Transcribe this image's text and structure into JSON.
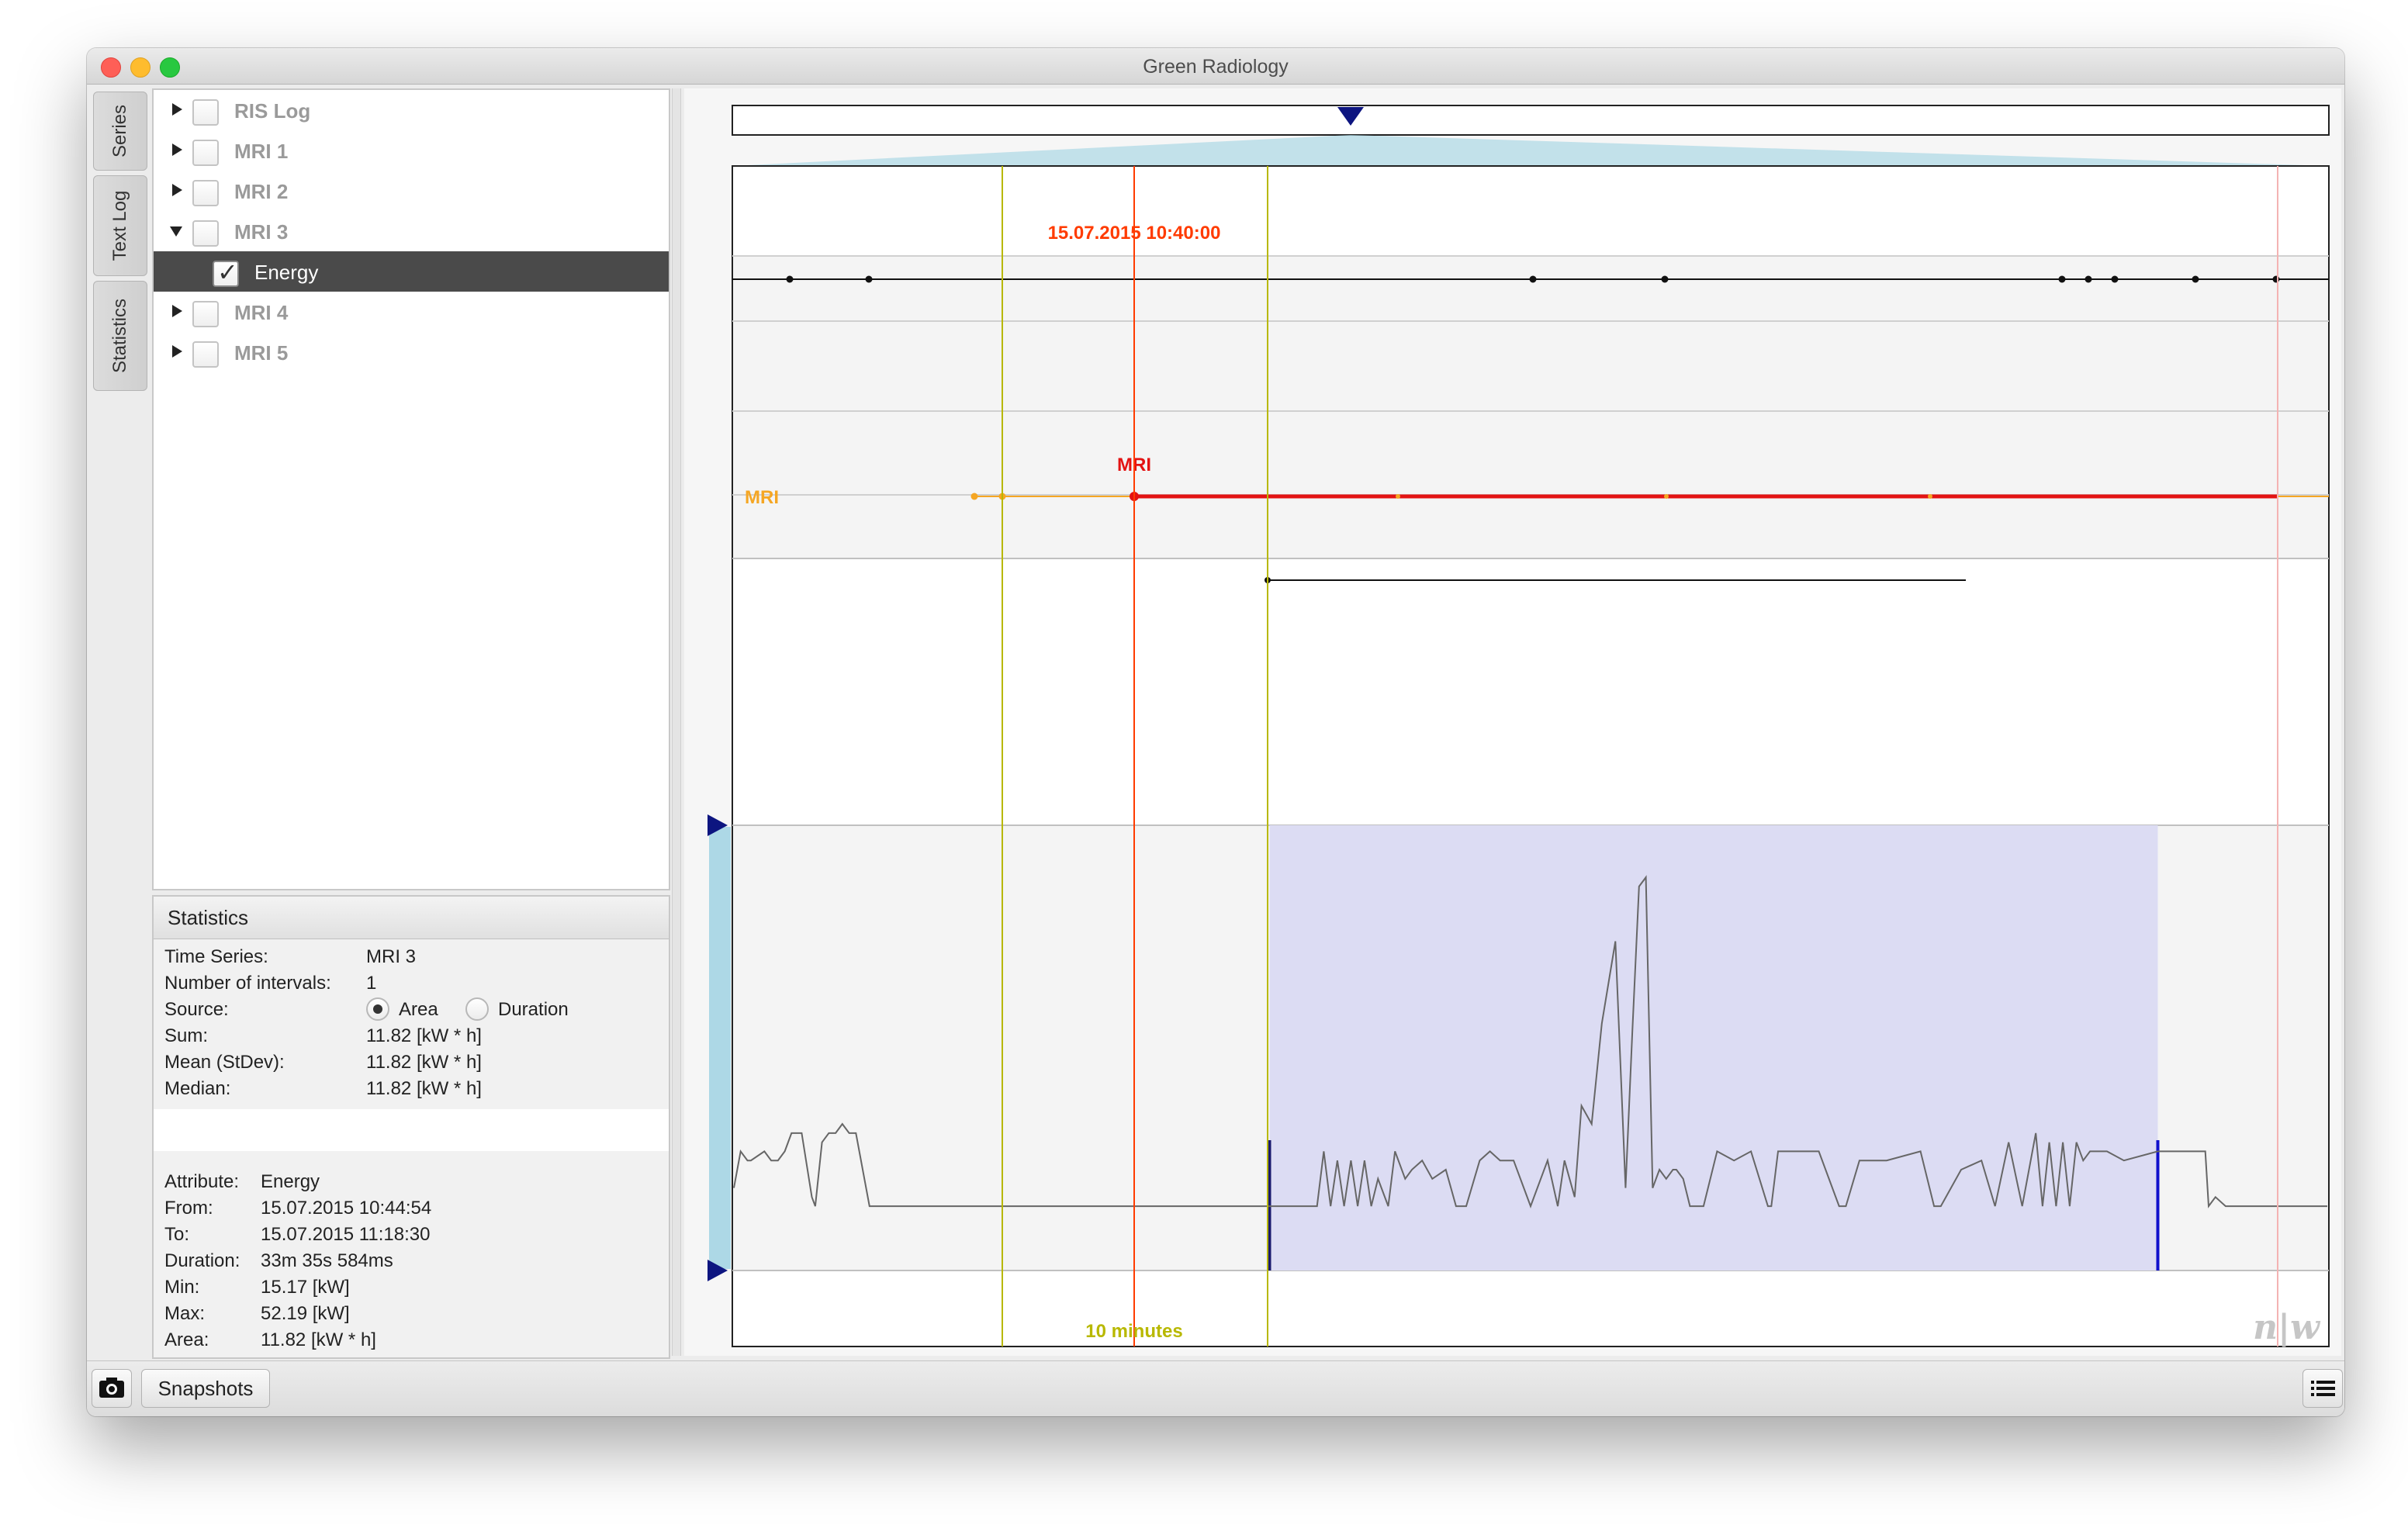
{
  "window": {
    "title": "Green Radiology"
  },
  "side_tabs": [
    {
      "label": "Series"
    },
    {
      "label": "Text Log"
    },
    {
      "label": "Statistics"
    }
  ],
  "tree": {
    "items": [
      {
        "label": "RIS Log",
        "expanded": false,
        "checked": false
      },
      {
        "label": "MRI 1",
        "expanded": false,
        "checked": false
      },
      {
        "label": "MRI 2",
        "expanded": false,
        "checked": false
      },
      {
        "label": "MRI 3",
        "expanded": true,
        "checked": false
      },
      {
        "label": "Energy",
        "child": true,
        "checked": true,
        "selected": true
      },
      {
        "label": "MRI 4",
        "expanded": false,
        "checked": false
      },
      {
        "label": "MRI 5",
        "expanded": false,
        "checked": false
      }
    ]
  },
  "statistics": {
    "header": "Statistics",
    "time_series_label": "Time Series:",
    "time_series_value": "MRI 3",
    "intervals_label": "Number of intervals:",
    "intervals_value": "1",
    "source_label": "Source:",
    "source_options": [
      "Area",
      "Duration"
    ],
    "source_selected": "Area",
    "sum_label": "Sum:",
    "sum_value": "11.82 [kW * h]",
    "mean_label": "Mean (StDev):",
    "mean_value": "11.82 [kW * h]",
    "median_label": "Median:",
    "median_value": "11.82 [kW * h]",
    "attribute_label": "Attribute:",
    "attribute_value": "Energy",
    "from_label": "From:",
    "from_value": "15.07.2015 10:44:54",
    "to_label": "To:",
    "to_value": "15.07.2015 11:18:30",
    "duration_label": "Duration:",
    "duration_value": "33m 35s 584ms",
    "min_label": "Min:",
    "min_value": "15.17 [kW]",
    "max_label": "Max:",
    "max_value": "52.19 [kW]",
    "area_label": "Area:",
    "area_value": "11.82 [kW * h]"
  },
  "timeline": {
    "cursor_label": "15.07.2015 10:40:00",
    "cursor_color": "#ff3b00",
    "lane_label": "MRI",
    "event_label": "MRI",
    "event_color": "#e31313",
    "lane_color": "#f5a623",
    "scale_label": "10 minutes",
    "scale_color": "#b8b800",
    "selection_color": "#dcdcf3",
    "overview_color": "#add8e6",
    "watermark": "n|w"
  },
  "chart_data": {
    "type": "line",
    "title": "",
    "series": [
      {
        "x": [
          0,
          4,
          8,
          10,
          18,
          22,
          26,
          30,
          34,
          40,
          46,
          48,
          52,
          56,
          60,
          64,
          68,
          72,
          80,
          100,
          140,
          170,
          200,
          240,
          280,
          320,
          344,
          348,
          352,
          356,
          360,
          364,
          368,
          372,
          376,
          380,
          386,
          390,
          396,
          400,
          406,
          412,
          420,
          426,
          432,
          440,
          446,
          452,
          460,
          470,
          476,
          480,
          486,
          490,
          496,
          500,
          506,
          512,
          520,
          526,
          530,
          534,
          538,
          542,
          546,
          550,
          554,
          556,
          560,
          564,
          568,
          572,
          580,
          590,
          600,
          610,
          612,
          616,
          640,
          652,
          656,
          664,
          680,
          700,
          708,
          712,
          724,
          736,
          744,
          752,
          760,
          768,
          772,
          776,
          780,
          784,
          788,
          792,
          796,
          800,
          804,
          810,
          820,
          840,
          860,
          868,
          870,
          874,
          880,
          900,
          940
        ],
        "values": [
          17,
          21,
          20,
          20,
          21,
          20,
          20,
          21,
          23,
          23,
          16,
          15,
          22,
          23,
          23,
          24,
          23,
          23,
          15,
          15,
          15,
          15,
          15,
          15,
          15,
          15,
          15,
          21,
          15,
          20,
          15,
          20,
          15,
          20,
          15,
          18,
          15,
          21,
          18,
          19,
          20,
          18,
          19,
          15,
          15,
          20,
          21,
          20,
          20,
          15,
          18,
          20,
          15,
          20,
          16,
          26,
          24,
          35,
          44,
          17,
          34,
          50,
          51,
          17,
          19,
          18,
          19,
          19,
          18,
          15,
          15,
          15,
          21,
          20,
          21,
          15,
          15,
          21,
          21,
          15,
          15,
          20,
          20,
          21,
          15,
          15,
          19,
          20,
          15,
          22,
          15,
          23,
          15,
          22,
          15,
          22,
          15,
          22,
          20,
          21,
          21,
          21,
          20,
          21,
          21,
          21,
          15,
          16,
          15,
          15,
          15
        ]
      }
    ],
    "xlim": [
      0,
      940
    ],
    "ylim": [
      10,
      55
    ],
    "grid": false,
    "selection": {
      "from_x": 316,
      "to_x": 840
    }
  },
  "bottom": {
    "snapshots_label": "Snapshots"
  }
}
